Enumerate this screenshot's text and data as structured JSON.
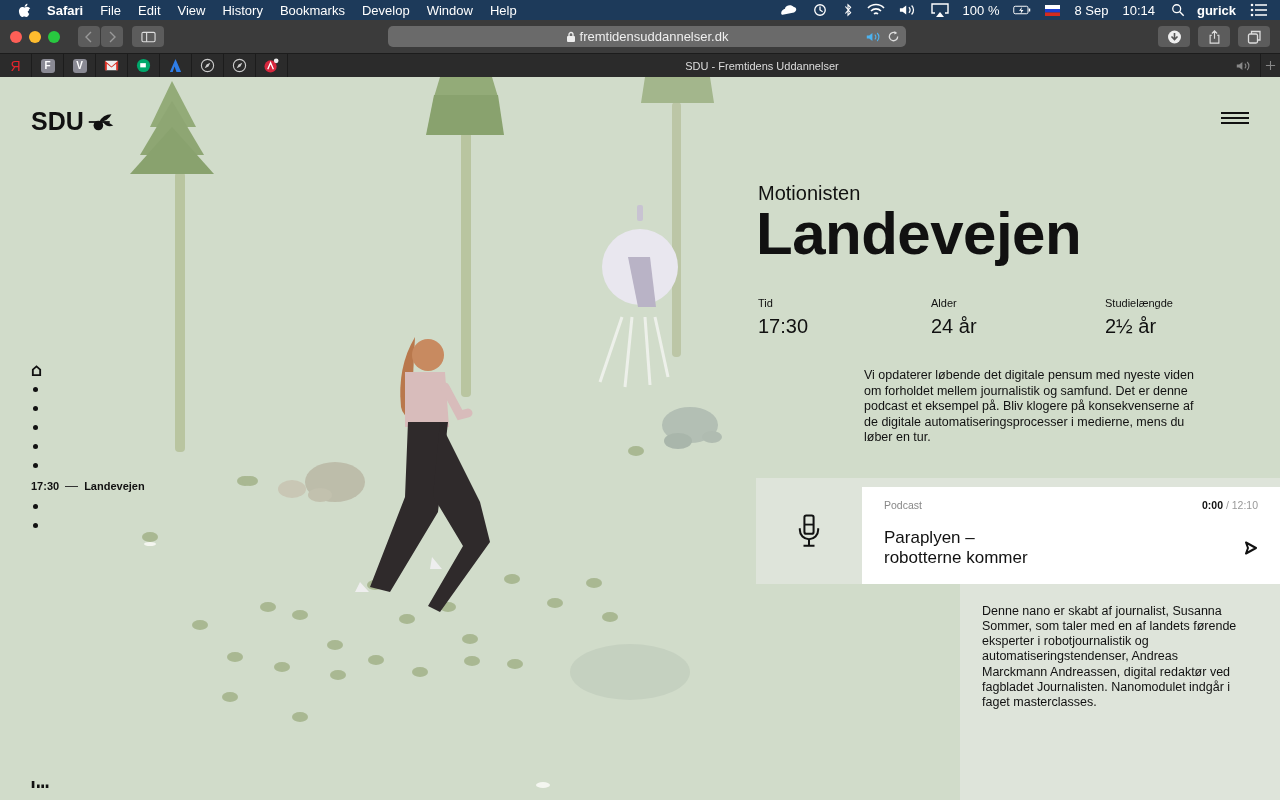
{
  "menu_bar": {
    "app": "Safari",
    "items": [
      "File",
      "Edit",
      "View",
      "History",
      "Bookmarks",
      "Develop",
      "Window",
      "Help"
    ],
    "battery": "100 %",
    "date": "8 Sep",
    "time": "10:14",
    "user": "gurick"
  },
  "browser": {
    "address": "fremtidensuddannelser.dk",
    "tab_title": "SDU - Fremtidens Uddannelser",
    "favorites": [
      {
        "kind": "letter",
        "label": "Я"
      },
      {
        "kind": "tile",
        "label": "F"
      },
      {
        "kind": "tile",
        "label": "V"
      },
      {
        "kind": "mail"
      },
      {
        "kind": "chat"
      },
      {
        "kind": "peak"
      },
      {
        "kind": "compass"
      },
      {
        "kind": "compass"
      },
      {
        "kind": "badge"
      }
    ]
  },
  "page": {
    "logo": "SDU",
    "nav": [
      {
        "kind": "home",
        "selected": false
      },
      {
        "kind": "dot",
        "selected": false
      },
      {
        "kind": "dot",
        "selected": false
      },
      {
        "kind": "dot",
        "selected": false
      },
      {
        "kind": "dot",
        "selected": false
      },
      {
        "kind": "dot",
        "selected": false
      },
      {
        "kind": "dot",
        "selected": true,
        "time": "17:30",
        "title": "Landevejen"
      },
      {
        "kind": "dot",
        "selected": false
      },
      {
        "kind": "dot",
        "selected": false
      }
    ],
    "subtitle": "Motionisten",
    "title": "Landevejen",
    "stats": [
      {
        "label": "Tid",
        "value": "17:30"
      },
      {
        "label": "Alder",
        "value": "24 år"
      },
      {
        "label": "Studielængde",
        "value": "2½ år"
      }
    ],
    "description": "Vi opdaterer løbende det digitale pensum med nyeste viden om forholdet mellem journalistik og samfund. Det er denne podcast et eksempel på. Bliv klogere på konsekvenserne af de digitale automatiseringsprocesser i medierne, mens du løber en tur.",
    "podcast": {
      "label": "Podcast",
      "time": "**0:00** / 12:10",
      "title_lines": [
        "Paraplyen –",
        "robotterne kommer"
      ]
    },
    "note": "Denne nano er skabt af journalist, Susanna Sommer, som taler med en af landets førende eksperter i robotjournalistik og automatiseringstendenser, Andreas Marckmann Andreassen, digital redaktør ved fagbladet Journalisten. Nanomodulet indgår i faget masterclasses."
  }
}
